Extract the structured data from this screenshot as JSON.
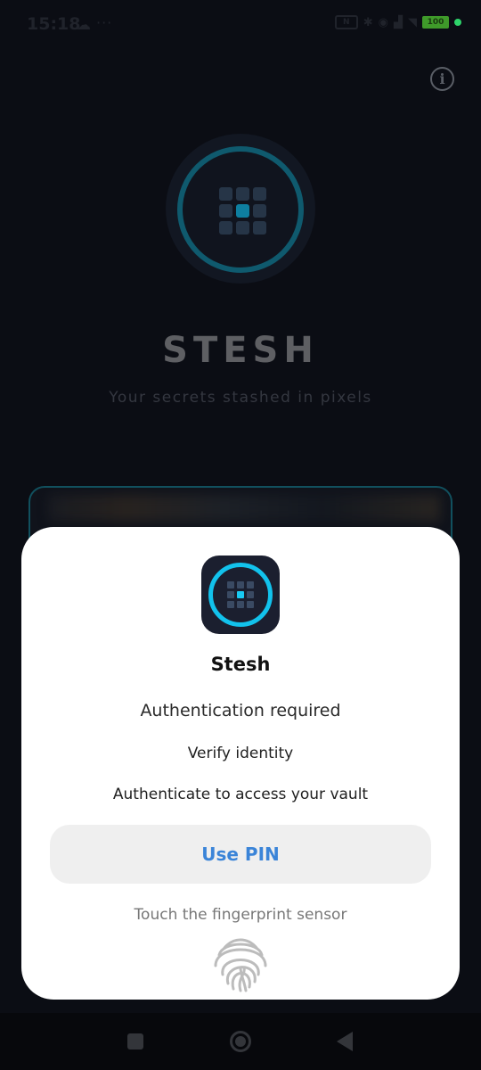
{
  "status_bar": {
    "time": "15:18",
    "dots": "···",
    "battery": "100"
  },
  "hero": {
    "title": "STESH",
    "subtitle": "Your secrets stashed in pixels"
  },
  "dialog": {
    "app_name": "Stesh",
    "title": "Authentication required",
    "subtitle": "Verify identity",
    "description": "Authenticate to access your vault",
    "use_pin_label": "Use PIN",
    "fingerprint_hint": "Touch the fingerprint sensor"
  },
  "icons": {
    "info": "info-icon",
    "app": "app-logo-icon",
    "fingerprint": "fingerprint-icon",
    "nav_recents": "recents-icon",
    "nav_home": "home-icon",
    "nav_back": "back-icon"
  },
  "colors": {
    "accent": "#12c2ec",
    "button_text": "#3a84d8",
    "background": "#0b0d14"
  }
}
